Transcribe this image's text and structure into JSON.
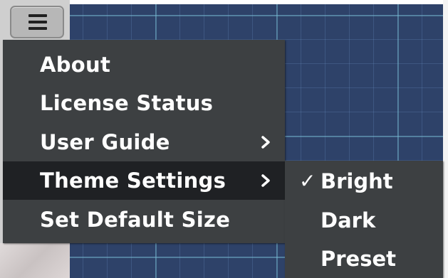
{
  "menu_button": {
    "icon": "hamburger-icon"
  },
  "main_menu": {
    "items": [
      {
        "label": "About",
        "has_submenu": false,
        "highlighted": false
      },
      {
        "label": "License Status",
        "has_submenu": false,
        "highlighted": false
      },
      {
        "label": "User Guide",
        "has_submenu": true,
        "highlighted": false
      },
      {
        "label": "Theme Settings",
        "has_submenu": true,
        "highlighted": true
      },
      {
        "label": "Set Default Size",
        "has_submenu": false,
        "highlighted": false
      }
    ]
  },
  "theme_submenu": {
    "items": [
      {
        "label": "Bright",
        "checked": true
      },
      {
        "label": "Dark",
        "checked": false
      },
      {
        "label": "Preset",
        "checked": false
      }
    ],
    "check_glyph": "✓"
  },
  "colors": {
    "menu_background": "#3d4042",
    "menu_highlight": "#1f2124",
    "canvas_background": "#2e4269",
    "grid_line": "#78bed2",
    "text": "#ffffff"
  },
  "icons": {
    "submenu_arrow": "chevron-right-icon",
    "selected_mark": "check-icon"
  }
}
